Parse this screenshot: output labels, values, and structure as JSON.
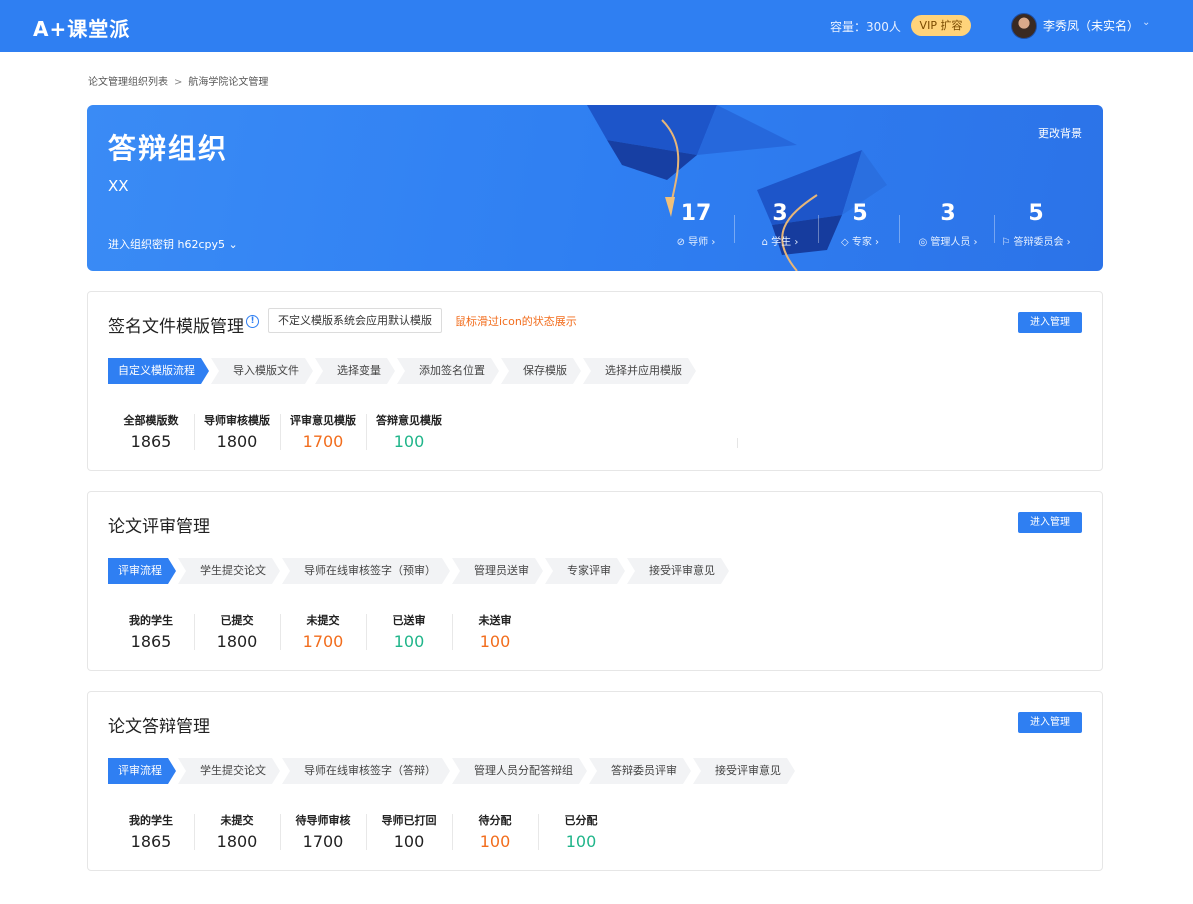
{
  "header": {
    "logo_text": "课堂派",
    "logo_mark": "A+",
    "capacity": "容量：300人",
    "vip_label": "VIP 扩容",
    "username": "李秀凤（未实名）",
    "caret": "⌄"
  },
  "breadcrumb": {
    "items": [
      "论文管理组织列表",
      "航海学院论文管理"
    ],
    "separator": ">"
  },
  "hero": {
    "title": "答辩组织",
    "subtitle": "XX",
    "key_label": "进入组织密钥 h62cpy5 ⌄",
    "change_bg": "更改背景",
    "stats": [
      {
        "value": "17",
        "label": "⊘ 导师 ›"
      },
      {
        "value": "3",
        "label": "⌂ 学生 ›"
      },
      {
        "value": "5",
        "label": "◇ 专家 ›"
      },
      {
        "value": "3",
        "label": "◎ 管理人员 ›"
      },
      {
        "value": "5",
        "label": "⚐ 答辩委员会 ›"
      }
    ]
  },
  "template_card": {
    "title": "签名文件模版管理",
    "tip_box": "不定义模版系统会应用默认模版",
    "tip_orange": "鼠标滑过icon的状态展示",
    "button": "进入管理",
    "steps": [
      "自定义模版流程",
      "导入模版文件",
      "选择变量",
      "添加签名位置",
      "保存模版",
      "选择并应用模版"
    ],
    "metrics": [
      {
        "label": "全部模版数",
        "value": "1865"
      },
      {
        "label": "导师审核模版",
        "value": "1800"
      },
      {
        "label": "评审意见模版",
        "value": "1700"
      },
      {
        "label": "答辩意见模版",
        "value": "100"
      }
    ]
  },
  "review_card": {
    "title": "论文评审管理",
    "button": "进入管理",
    "steps": [
      "评审流程",
      "学生提交论文",
      "导师在线审核签字（预审）",
      "管理员送审",
      "专家评审",
      "接受评审意见"
    ],
    "metrics": [
      {
        "label": "我的学生",
        "value": "1865"
      },
      {
        "label": "已提交",
        "value": "1800"
      },
      {
        "label": "未提交",
        "value": "1700"
      },
      {
        "label": "已送审",
        "value": "100"
      },
      {
        "label": "未送审",
        "value": "100"
      }
    ]
  },
  "defense_card": {
    "title": "论文答辩管理",
    "button": "进入管理",
    "steps": [
      "评审流程",
      "学生提交论文",
      "导师在线审核签字（答辩）",
      "管理人员分配答辩组",
      "答辩委员评审",
      "接受评审意见"
    ],
    "metrics": [
      {
        "label": "我的学生",
        "value": "1865"
      },
      {
        "label": "未提交",
        "value": "1800"
      },
      {
        "label": "待导师审核",
        "value": "1700"
      },
      {
        "label": "导师已打回",
        "value": "100"
      },
      {
        "label": "待分配",
        "value": "100"
      },
      {
        "label": "已分配",
        "value": "100"
      }
    ]
  },
  "colors": {
    "primary": "#2f7ff2",
    "orange": "#f26d1d",
    "green": "#20b58a",
    "vip": "#ffd37a"
  }
}
